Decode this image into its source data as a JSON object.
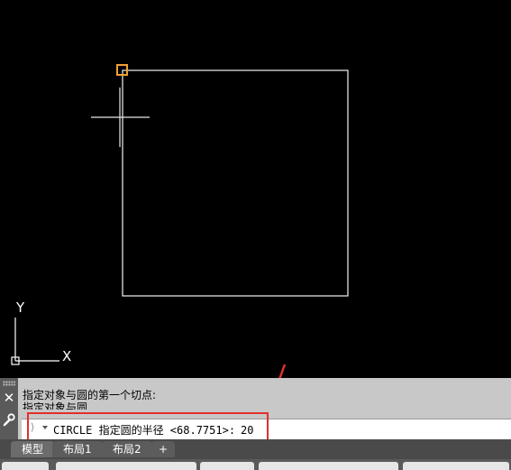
{
  "canvas": {
    "background": "#000000",
    "axis": {
      "y_label": "Y",
      "x_label": "X"
    },
    "square_color": "#ffffff",
    "snap_marker_color": "#f0a030"
  },
  "command": {
    "history": [
      "指定对象与圆的第一个切点:",
      "指定对象与圆"
    ],
    "prompt": "CIRCLE 指定圆的半径 <68.7751>:",
    "value": "20",
    "close_icon": "close-icon",
    "settings_icon": "wrench-icon",
    "highlight_color": "#e0302c"
  },
  "tabs": [
    {
      "label": "模型",
      "active": true
    },
    {
      "label": "布局1",
      "active": false
    },
    {
      "label": "布局2",
      "active": false
    },
    {
      "label": "+",
      "active": false
    }
  ]
}
